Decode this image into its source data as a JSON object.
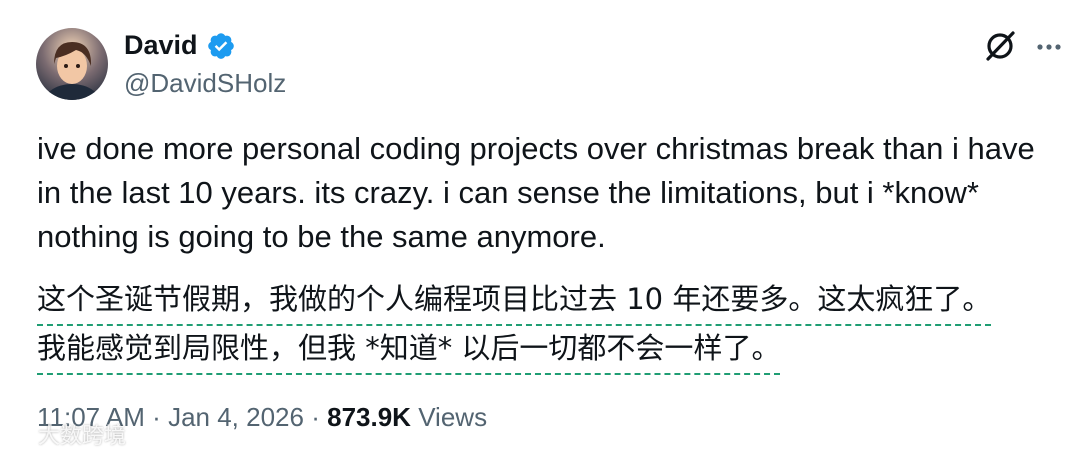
{
  "author": {
    "display_name": "David",
    "handle": "@DavidSHolz",
    "verified": true,
    "verified_color": "#1d9bf0"
  },
  "tweet": {
    "text_lines": [
      "ive done more personal coding projects over christmas break than i have",
      "in the last 10 years. its crazy. i can sense the limitations, but i *know*",
      "nothing is going to be the same anymore."
    ],
    "translation_lines": [
      "这个圣诞节假期，我做的个人编程项目比过去 10 年还要多。这太疯狂了。",
      "我能感觉到局限性，但我 *知道* 以后一切都不会一样了。"
    ],
    "translation_underline_color": "#1f9d73"
  },
  "meta": {
    "time": "11:07 AM",
    "separator": "·",
    "date": "Jan 4, 2026",
    "views_count": "873.9K",
    "views_label": "Views"
  },
  "icons": {
    "grok": "grok-icon",
    "more": "more-options-icon",
    "verified": "verified-badge-icon"
  },
  "watermark": {
    "text": "大数跨境"
  }
}
